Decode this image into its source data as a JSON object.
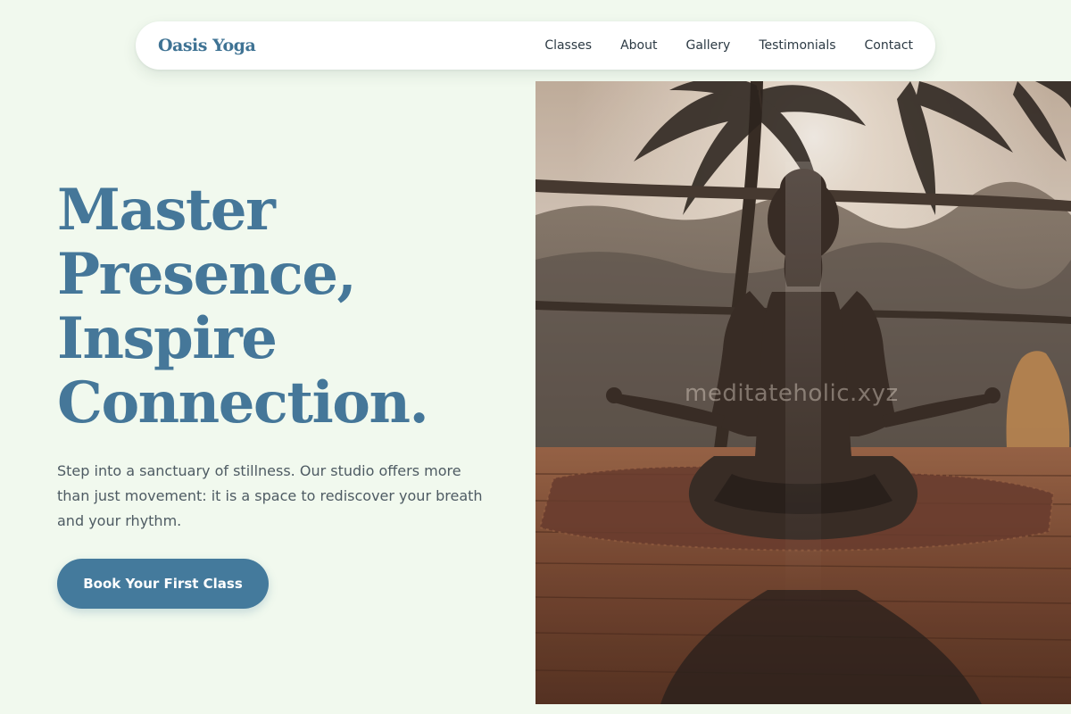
{
  "nav": {
    "brand": "Oasis Yoga",
    "links": [
      "Classes",
      "About",
      "Gallery",
      "Testimonials",
      "Contact"
    ]
  },
  "hero": {
    "headline_lines": [
      "Master",
      "Presence,",
      "Inspire",
      "Connection."
    ],
    "description": "Step into a sanctuary of stillness. Our studio offers more than just movement: it is a space to rediscover your breath and your rhythm.",
    "cta_label": "Book Your First Class"
  },
  "image": {
    "subject": "woman meditating in lotus pose at sunset on a wooden deck under palm trees",
    "watermark": "meditateholic.xyz"
  },
  "colors": {
    "background": "#f1f9ee",
    "accent": "#447a9c",
    "heading": "#457799",
    "body_text": "#4e5b63",
    "nav_text": "#2c3a44"
  }
}
